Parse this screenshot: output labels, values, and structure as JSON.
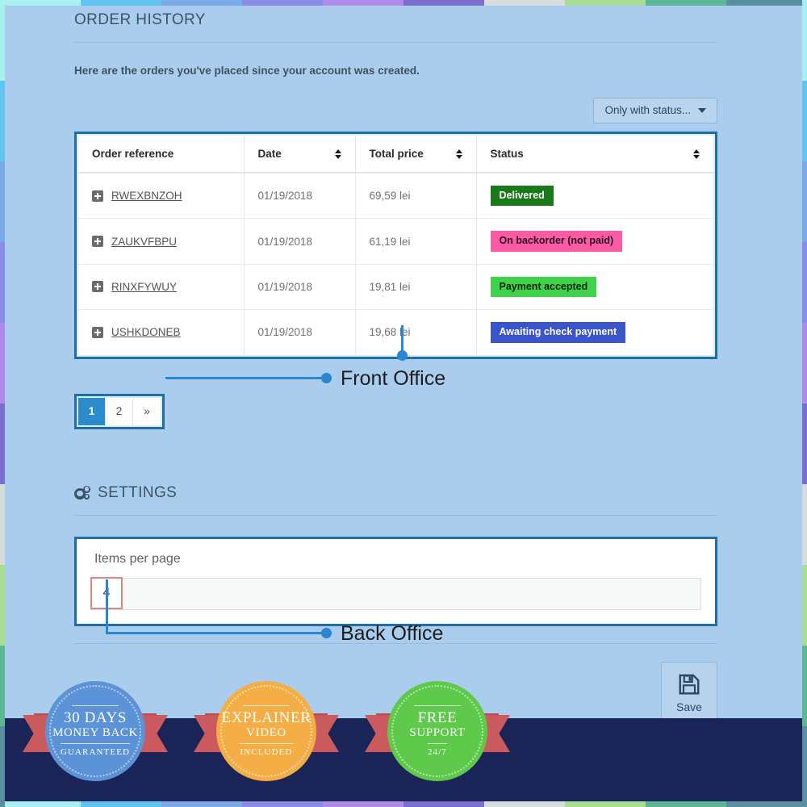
{
  "page": {
    "background_color": "#aacdee",
    "accent_color": "#1e6fa8",
    "annotation_color": "#2a86d0"
  },
  "order_history": {
    "heading": "ORDER HISTORY",
    "intro": "Here are the orders you've placed since your account was created.",
    "filter_label": "Only with status...",
    "columns": [
      {
        "label": "Order reference",
        "sortable": false
      },
      {
        "label": "Date",
        "sortable": true
      },
      {
        "label": "Total price",
        "sortable": true
      },
      {
        "label": "Status",
        "sortable": true
      }
    ],
    "rows": [
      {
        "reference": "RWEXBNZOH",
        "date": "01/19/2018",
        "total": "69,59 lei",
        "status": "Delivered",
        "status_bg": "#1a7a1a",
        "status_fg": "#ffffff"
      },
      {
        "reference": "ZAUKVFBPU",
        "date": "01/19/2018",
        "total": "61,19 lei",
        "status": "On backorder (not paid)",
        "status_bg": "#fb5ba4",
        "status_fg": "#2b1122"
      },
      {
        "reference": "RINXFYWUY",
        "date": "01/19/2018",
        "total": "19,81 lei",
        "status": "Payment accepted",
        "status_bg": "#3ed martin",
        "status_fg": "#14240f"
      },
      {
        "reference": "USHKDONEB",
        "date": "01/19/2018",
        "total": "19,68 lei",
        "status": "Awaiting check payment",
        "status_bg": "#3a55cc",
        "status_fg": "#ffffff"
      }
    ],
    "pagination": {
      "pages": [
        "1",
        "2",
        "»"
      ],
      "active_index": 0
    }
  },
  "settings": {
    "heading": "SETTINGS",
    "items_per_page_label": "Items per page",
    "items_per_page_value": "4",
    "save_label": "Save"
  },
  "annotations": [
    {
      "label": "Front Office"
    },
    {
      "label": "Back Office"
    }
  ],
  "promo_badges": [
    {
      "line1": "30 DAYS",
      "line2": "MONEY BACK",
      "line3": "GUARANTEED",
      "color": "#5b93d6"
    },
    {
      "line1": "EXPLAINER",
      "line2": "VIDEO",
      "line3": "INCLUDED",
      "color": "#f5ad45"
    },
    {
      "line1": "FREE",
      "line2": "SUPPORT",
      "line3": "24/7",
      "color": "#5ec94a"
    }
  ],
  "edge_strip_colors": [
    "#a8f0ee",
    "#63c3f0",
    "#7ca9e8",
    "#8a8ce8",
    "#b08ae8",
    "#7a6fd0",
    "#d6dbdb",
    "#a8dd92",
    "#5cb894",
    "#5a8fa0"
  ]
}
